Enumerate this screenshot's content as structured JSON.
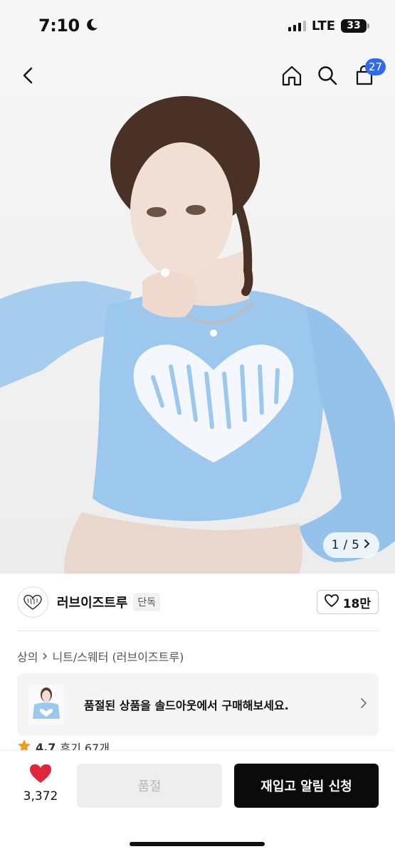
{
  "status_bar": {
    "time": "7:10",
    "network": "LTE",
    "battery": "33",
    "icons": [
      "moon-icon",
      "signal-icon",
      "battery-icon"
    ]
  },
  "nav": {
    "icons": [
      "back-icon",
      "home-icon",
      "search-icon",
      "cart-icon"
    ],
    "cart_count": "27"
  },
  "gallery": {
    "current": "1",
    "separator": "/",
    "total": "5",
    "sweater_color": "#9cc8ee"
  },
  "brand": {
    "name": "러브이즈트루",
    "tag": "단독",
    "wish_count": "18만"
  },
  "breadcrumb": {
    "category": "상의",
    "subcategory": "니트/스웨터 (러브이즈트루)"
  },
  "soldout_banner": {
    "text": "품절된 상품을 솔드아웃에서 구매해보세요."
  },
  "review": {
    "rating": "4.7",
    "label": "후기 67개"
  },
  "bottom_bar": {
    "like_count": "3,372",
    "soldout_label": "품절",
    "restock_label": "재입고 알림 신청",
    "colors": {
      "heart": "#e0263a",
      "primary": "#0b0b0b",
      "disabled_bg": "#eeeeee",
      "badge": "#2e6bf0"
    }
  }
}
